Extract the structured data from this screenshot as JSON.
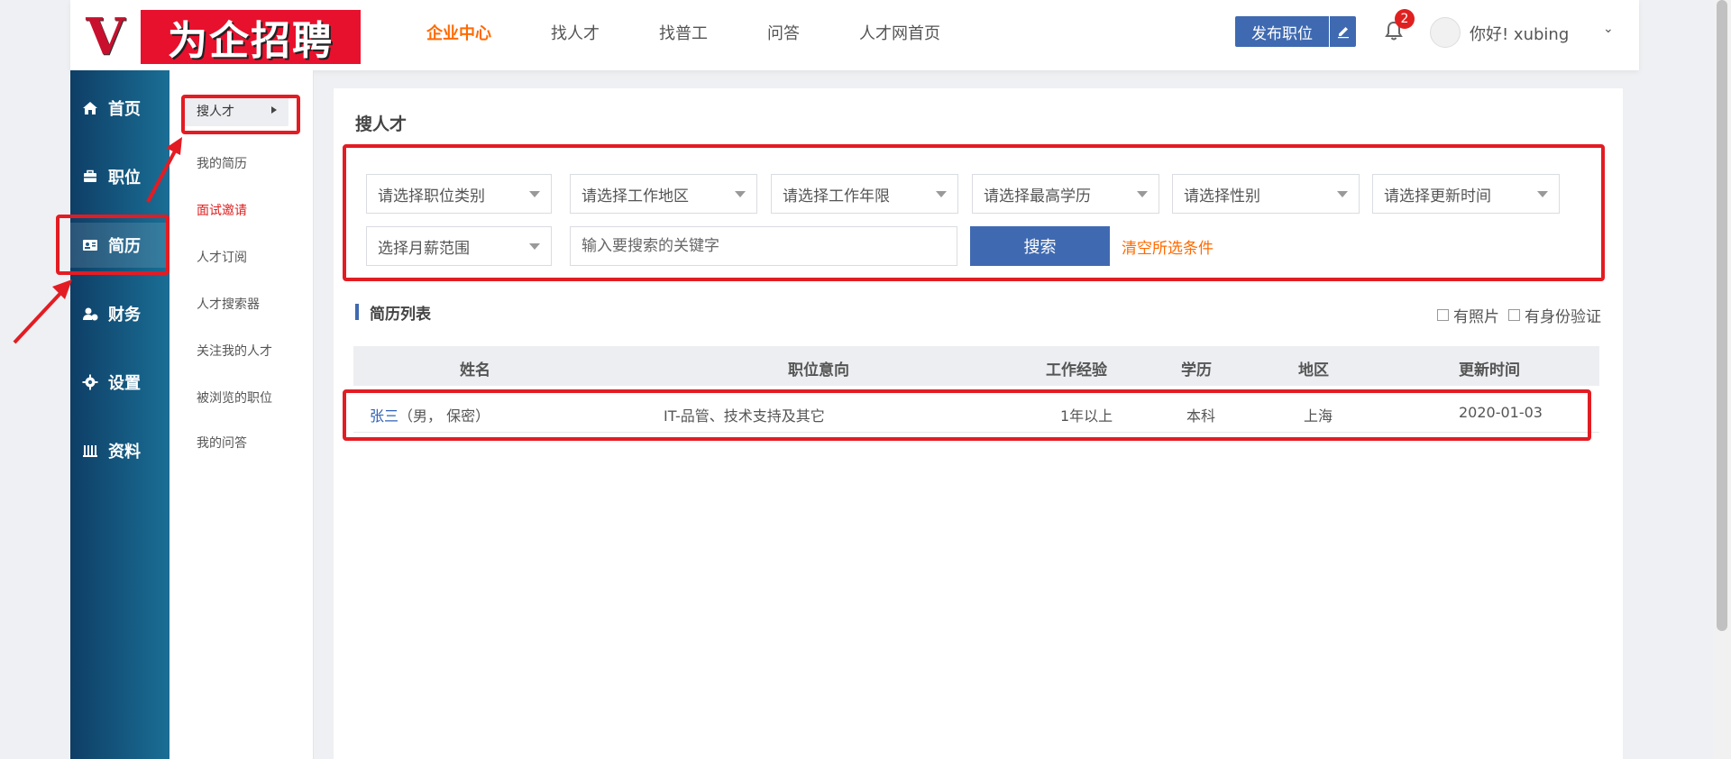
{
  "logo": {
    "letter": "V",
    "title": "为企招聘"
  },
  "topnav": [
    {
      "label": "企业中心",
      "active": true
    },
    {
      "label": "找人才",
      "active": false
    },
    {
      "label": "找普工",
      "active": false
    },
    {
      "label": "问答",
      "active": false
    },
    {
      "label": "人才网首页",
      "active": false
    }
  ],
  "header": {
    "publish_label": "发布职位",
    "notification_count": "2",
    "greeting": "你好! xubing",
    "caret": "⌄"
  },
  "sidebar": [
    {
      "label": "首页",
      "icon": "home-icon"
    },
    {
      "label": "职位",
      "icon": "briefcase-icon"
    },
    {
      "label": "简历",
      "icon": "id-card-icon",
      "active": true
    },
    {
      "label": "财务",
      "icon": "finance-icon"
    },
    {
      "label": "设置",
      "icon": "gear-icon"
    },
    {
      "label": "资料",
      "icon": "data-icon"
    }
  ],
  "submenu": {
    "active_label": "搜人才",
    "items": [
      "我的简历",
      "面试邀请",
      "人才订阅",
      "人才搜索器",
      "关注我的人才",
      "被浏览的职位",
      "我的问答"
    ]
  },
  "panel": {
    "title": "搜人才",
    "filters": [
      "请选择职位类别",
      "请选择工作地区",
      "请选择工作年限",
      "请选择最高学历",
      "请选择性别",
      "请选择更新时间",
      "选择月薪范围"
    ],
    "keyword_placeholder": "输入要搜索的关键字",
    "search_label": "搜索",
    "clear_label": "清空所选条件",
    "list_title": "简历列表",
    "check_photo": "有照片",
    "check_id": "有身份验证"
  },
  "table": {
    "headers": [
      "姓名",
      "职位意向",
      "工作经验",
      "学历",
      "地区",
      "更新时间"
    ],
    "rows": [
      {
        "name": "张三",
        "meta": "（男， 保密）",
        "intent": "IT-品管、技术支持及其它",
        "experience": "1年以上",
        "education": "本科",
        "region": "上海",
        "updated": "2020-01-03"
      }
    ]
  },
  "colors": {
    "brand_blue": "#3f6ab1",
    "accent_orange": "#ff6a00",
    "annotation_red": "#e31c23"
  }
}
